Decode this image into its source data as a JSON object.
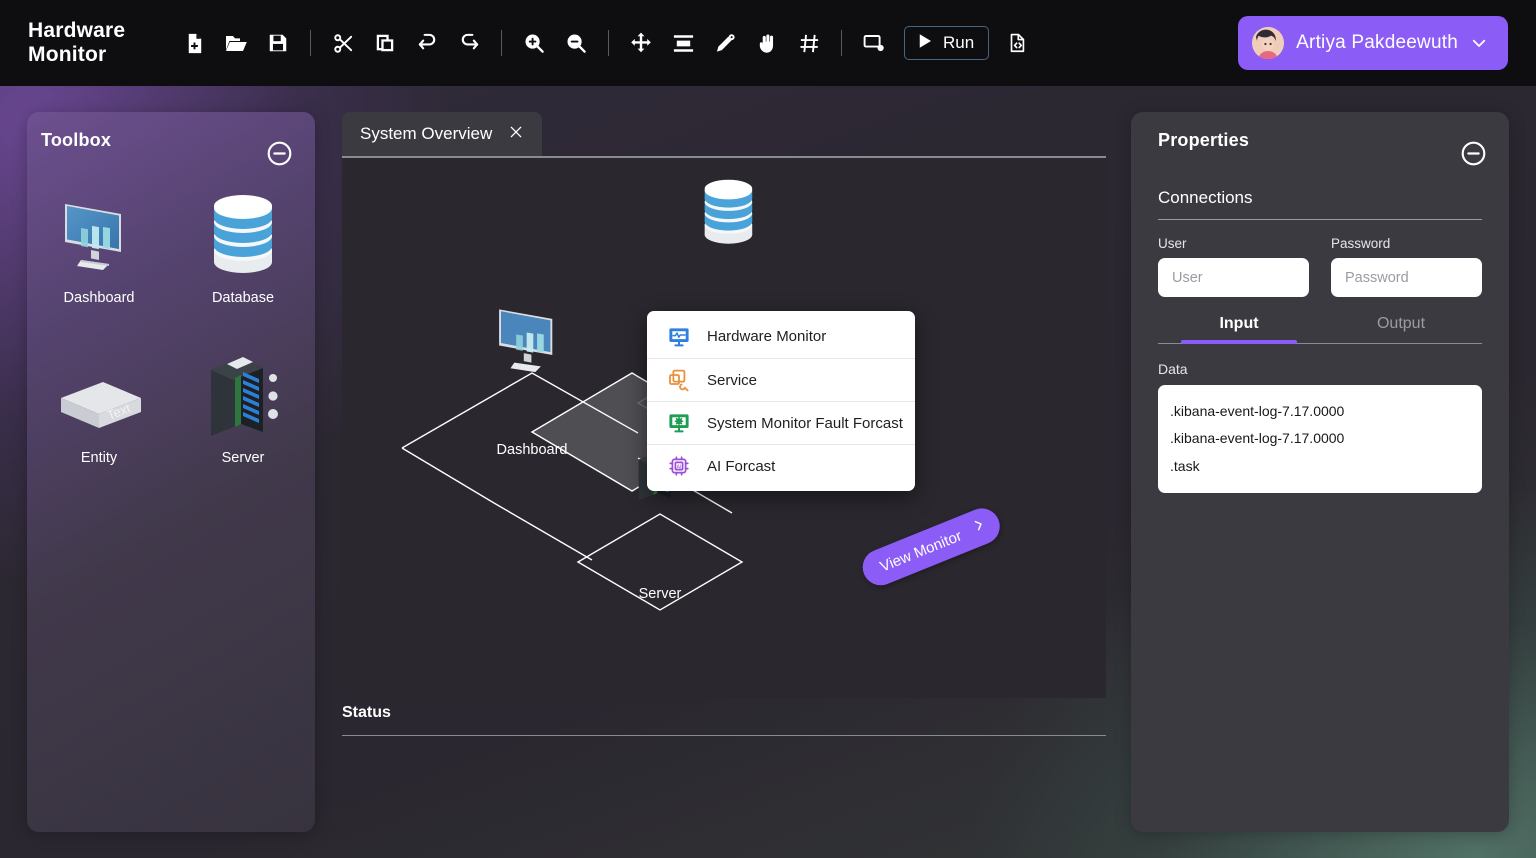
{
  "app": {
    "brand_line1": "Hardware",
    "brand_line2": "Monitor"
  },
  "toolbar": {
    "buttons": [
      {
        "name": "new-file",
        "icon": "new-file-icon"
      },
      {
        "name": "open-folder",
        "icon": "folder-open-icon"
      },
      {
        "name": "save",
        "icon": "save-icon"
      },
      {
        "name": "cut",
        "icon": "scissors-icon"
      },
      {
        "name": "copy",
        "icon": "copy-icon"
      },
      {
        "name": "undo",
        "icon": "undo-icon"
      },
      {
        "name": "redo",
        "icon": "redo-icon"
      },
      {
        "name": "zoom-in",
        "icon": "zoom-in-icon"
      },
      {
        "name": "zoom-out",
        "icon": "zoom-out-icon"
      },
      {
        "name": "move",
        "icon": "move-arrows-icon"
      },
      {
        "name": "align",
        "icon": "align-icon"
      },
      {
        "name": "edit-pen",
        "icon": "pen-settings-icon"
      },
      {
        "name": "pan-hand",
        "icon": "hand-icon"
      },
      {
        "name": "grid",
        "icon": "grid-icon"
      },
      {
        "name": "monitor-record",
        "icon": "monitor-record-icon"
      },
      {
        "name": "code-file",
        "icon": "code-file-icon"
      }
    ],
    "run_label": "Run"
  },
  "user": {
    "name": "Artiya Pakdeewuth",
    "accent": "#8b5cf6"
  },
  "toolbox": {
    "title": "Toolbox",
    "collapse_icon": "minus-circle-icon",
    "items": [
      {
        "label": "Dashboard",
        "icon": "monitor-isometric-icon"
      },
      {
        "label": "Database",
        "icon": "database-cylinder-icon"
      },
      {
        "label": "Entity",
        "icon": "entity-slab-icon",
        "face_text": "Text"
      },
      {
        "label": "Server",
        "icon": "server-rack-icon"
      }
    ]
  },
  "canvas": {
    "tab": {
      "label": "System Overview",
      "close_icon": "close-icon"
    },
    "nodes": [
      {
        "label": "Database",
        "icon": "database-cylinder-icon"
      },
      {
        "label": "Dashboard",
        "icon": "monitor-isometric-icon"
      },
      {
        "label": "Server",
        "icon": "server-rack-icon"
      }
    ],
    "badge": {
      "label": "View Monitor",
      "chevron": "chevron-right-icon",
      "color": "#8b5cf6"
    },
    "status_label": "Status"
  },
  "context_menu": {
    "items": [
      {
        "label": "Hardware Monitor",
        "icon": "hardware-monitor-icon",
        "color": "#2f7fe0"
      },
      {
        "label": "Service",
        "icon": "service-wrench-icon",
        "color": "#e8913a"
      },
      {
        "label": "System Monitor Fault Forcast",
        "icon": "system-monitor-gear-icon",
        "color": "#1f9d55"
      },
      {
        "label": "AI Forcast",
        "icon": "ai-chip-icon",
        "color": "#9b4fd8"
      }
    ]
  },
  "properties": {
    "title": "Properties",
    "collapse_icon": "minus-circle-icon",
    "section": "Connections",
    "user_field": {
      "label": "User",
      "value": "",
      "placeholder": "User"
    },
    "password_field": {
      "label": "Password",
      "value": "",
      "placeholder": "Password"
    },
    "tabs": [
      {
        "label": "Input",
        "active": true
      },
      {
        "label": "Output",
        "active": false
      }
    ],
    "data_label": "Data",
    "data_lines": [
      ".kibana-event-log-7.17.0000",
      ".kibana-event-log-7.17.0000",
      ".task"
    ]
  }
}
